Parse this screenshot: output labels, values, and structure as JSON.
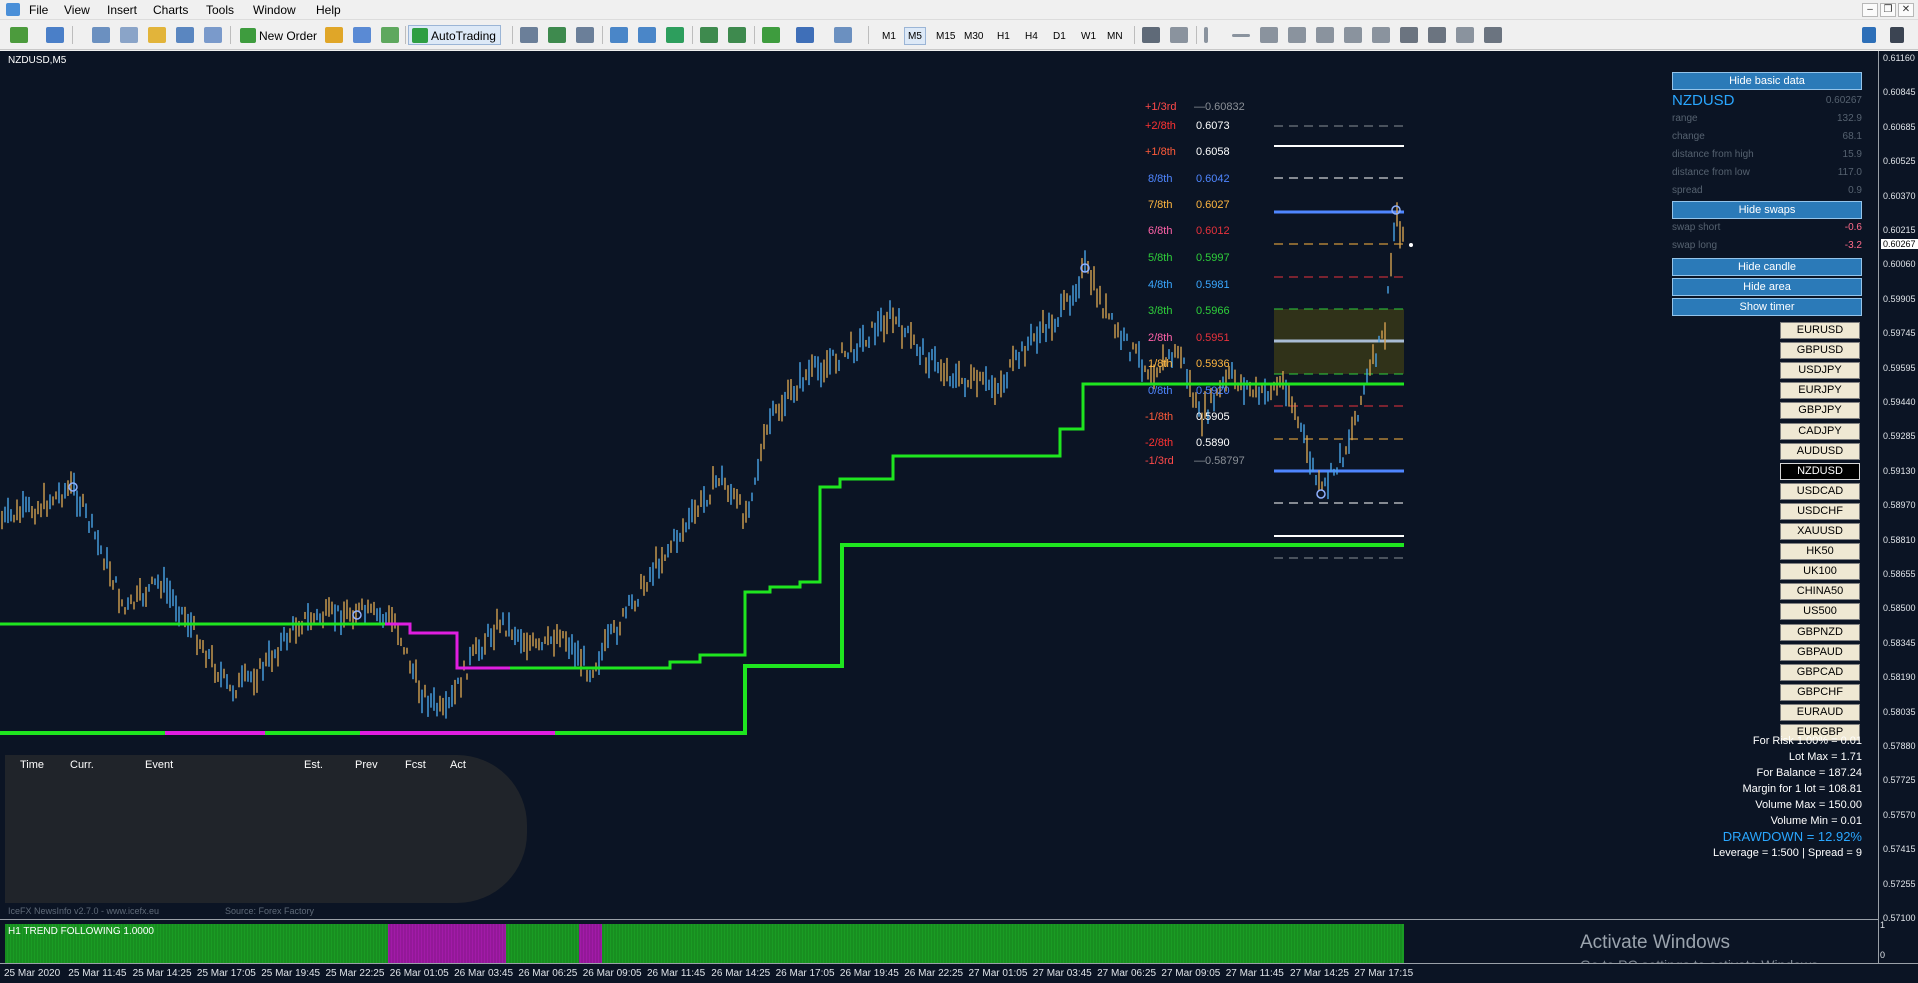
{
  "menu": [
    "File",
    "View",
    "Insert",
    "Charts",
    "Tools",
    "Window",
    "Help"
  ],
  "toolbar": {
    "new_order": "New Order",
    "auto_trading": "AutoTrading",
    "timeframes": [
      "M1",
      "M5",
      "M15",
      "M30",
      "H1",
      "H4",
      "D1",
      "W1",
      "MN"
    ],
    "active_timeframe": "M5"
  },
  "chart": {
    "symbol_label": "NZDUSD,M5",
    "current_price": "0.60267",
    "price_axis": [
      "0.61160",
      "0.60845",
      "0.60685",
      "0.60525",
      "0.60370",
      "0.60215",
      "0.60060",
      "0.59905",
      "0.59745",
      "0.59595",
      "0.59440",
      "0.59285",
      "0.59130",
      "0.58970",
      "0.58810",
      "0.58655",
      "0.58500",
      "0.58345",
      "0.58190",
      "0.58035",
      "0.57880",
      "0.57725",
      "0.57570",
      "0.57415",
      "0.57255",
      "0.57100"
    ],
    "time_axis": [
      "25 Mar 2020",
      "25 Mar 11:45",
      "25 Mar 14:25",
      "25 Mar 17:05",
      "25 Mar 19:45",
      "25 Mar 22:25",
      "26 Mar 01:05",
      "26 Mar 03:45",
      "26 Mar 06:25",
      "26 Mar 09:05",
      "26 Mar 11:45",
      "26 Mar 14:25",
      "26 Mar 17:05",
      "26 Mar 19:45",
      "26 Mar 22:25",
      "27 Mar 01:05",
      "27 Mar 03:45",
      "27 Mar 06:25",
      "27 Mar 09:05",
      "27 Mar 11:45",
      "27 Mar 14:25",
      "27 Mar 17:15"
    ]
  },
  "murrey": [
    {
      "label": "+1/3rd",
      "value": "—0.60832",
      "label_color": "#ff4a4a",
      "value_color": "#8a8f96"
    },
    {
      "label": "+2/8th",
      "value": "0.6073",
      "label_color": "#ff3333",
      "value_color": "#ffffff"
    },
    {
      "label": "+1/8th",
      "value": "0.6058",
      "label_color": "#ff5b3a",
      "value_color": "#ffffff"
    },
    {
      "label": "8/8th",
      "value": "0.6042",
      "label_color": "#4f86ff",
      "value_color": "#4f86ff"
    },
    {
      "label": "7/8th",
      "value": "0.6027",
      "label_color": "#ffb640",
      "value_color": "#ffb640"
    },
    {
      "label": "6/8th",
      "value": "0.6012",
      "label_color": "#ff62a8",
      "value_color": "#e8323c"
    },
    {
      "label": "5/8th",
      "value": "0.5997",
      "label_color": "#2fcf3a",
      "value_color": "#2fcf3a"
    },
    {
      "label": "4/8th",
      "value": "0.5981",
      "label_color": "#3aa7ff",
      "value_color": "#3aa7ff"
    },
    {
      "label": "3/8th",
      "value": "0.5966",
      "label_color": "#2fcf3a",
      "value_color": "#2fcf3a"
    },
    {
      "label": "2/8th",
      "value": "0.5951",
      "label_color": "#ff62a8",
      "value_color": "#e8323c"
    },
    {
      "label": "1/8th",
      "value": "0.5936",
      "label_color": "#ffb640",
      "value_color": "#ffb640"
    },
    {
      "label": "0/8th",
      "value": "0.5920",
      "label_color": "#4f86ff",
      "value_color": "#4f86ff"
    },
    {
      "label": "-1/8th",
      "value": "0.5905",
      "label_color": "#ff5b3a",
      "value_color": "#ffffff"
    },
    {
      "label": "-2/8th",
      "value": "0.5890",
      "label_color": "#ff3333",
      "value_color": "#ffffff"
    },
    {
      "label": "-1/3rd",
      "value": "—0.58797",
      "label_color": "#ff4a4a",
      "value_color": "#8a8f96"
    }
  ],
  "info_panel": {
    "hide_basic_data": "Hide basic data",
    "symbol": "NZDUSD",
    "symbol_price": "0.60267",
    "rows": [
      {
        "label": "range",
        "value": "132.9"
      },
      {
        "label": "change",
        "value": "68.1"
      },
      {
        "label": "distance from high",
        "value": "15.9"
      },
      {
        "label": "distance from low",
        "value": "117.0"
      },
      {
        "label": "spread",
        "value": "0.9"
      }
    ],
    "hide_swaps": "Hide swaps",
    "swaps": [
      {
        "label": "swap short",
        "value": "-0.6"
      },
      {
        "label": "swap long",
        "value": "-3.2"
      }
    ],
    "hide_candle": "Hide candle",
    "hide_area": "Hide area",
    "show_timer": "Show timer"
  },
  "symbols": [
    "EURUSD",
    "GBPUSD",
    "USDJPY",
    "EURJPY",
    "GBPJPY",
    "CADJPY",
    "AUDUSD",
    "NZDUSD",
    "USDCAD",
    "USDCHF",
    "XAUUSD",
    "HK50",
    "UK100",
    "CHINA50",
    "US500",
    "GBPNZD",
    "GBPAUD",
    "GBPCAD",
    "GBPCHF",
    "EURAUD",
    "EURGBP"
  ],
  "active_symbol": "NZDUSD",
  "risk": {
    "for_risk": "For Risk 1.00% = 0.01",
    "lot_max": "Lot Max = 1.71",
    "for_balance": "For Balance = 187.24",
    "margin": "Margin for 1 lot = 108.81",
    "volume_max": "Volume Max = 150.00",
    "volume_min": "Volume Min = 0.01",
    "drawdown": "DRAWDOWN =  12.92%",
    "leverage": "Leverage = 1:500 | Spread = 9"
  },
  "news": {
    "headers": [
      "Time",
      "Curr.",
      "Event",
      "Est.",
      "Prev",
      "Fcst",
      "Act"
    ],
    "footer_left": "IceFX NewsInfo v2.7.0  -  www.icefx.eu",
    "footer_right": "Source: Forex Factory"
  },
  "subwindow": {
    "label": "H1 TREND FOLLOWING 1.0000",
    "axis_top": "1",
    "axis_bottom": "0"
  },
  "watermark": {
    "line1": "Activate Windows",
    "line2": "Go to PC settings to activate Windows."
  },
  "colors": {
    "chart_bg": "#0b1424",
    "trend_green": "#1fe61f",
    "trend_magenta": "#e01ee0",
    "panel_blue": "#2b7ab8",
    "drawdown": "#2aa7ff"
  }
}
